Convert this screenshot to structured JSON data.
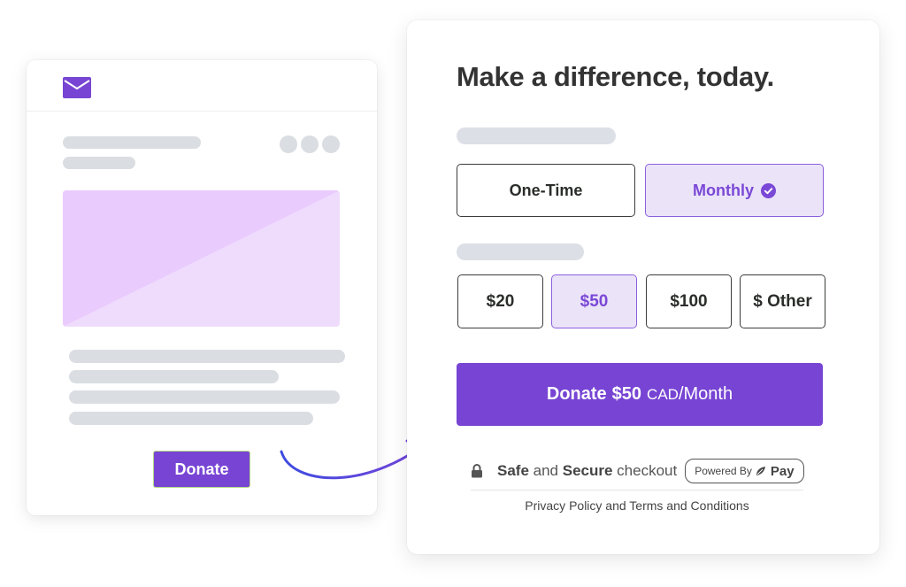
{
  "email_preview": {
    "icon": "mail-icon",
    "donate_button": "Donate",
    "colors": {
      "accent": "#7744d4",
      "image_top": "#e9cbfd",
      "image_bottom": "#efdcfd",
      "skeleton": "#dadde2"
    }
  },
  "arrow": {
    "icon": "curved-arrow-icon",
    "color_start": "#3d4be0",
    "color_end": "#7a44d8"
  },
  "donation_form": {
    "title": "Make a difference, today.",
    "frequency_options": [
      {
        "label": "One-Time",
        "selected": false
      },
      {
        "label": "Monthly",
        "selected": true,
        "icon": "check-circle-icon"
      }
    ],
    "amount_options": [
      {
        "label": "$20",
        "selected": false
      },
      {
        "label": "$50",
        "selected": true
      },
      {
        "label": "$100",
        "selected": false
      },
      {
        "label": "$ Other",
        "selected": false
      }
    ],
    "cta": {
      "action": "Donate",
      "amount": "$50",
      "currency": "CAD",
      "period": "/Month"
    },
    "secure": {
      "word1": "Safe",
      "and": " and ",
      "word2": "Secure",
      "tail": " checkout",
      "icon": "lock-icon"
    },
    "powered_by": {
      "label": "Powered By",
      "brand": "Pay",
      "icon": "leaf-logo-icon"
    },
    "legal_link": "Privacy Policy and Terms and Conditions",
    "colors": {
      "accent": "#7744d4",
      "selected_bg": "#ebe4f9",
      "selected_border": "#8b5fdd",
      "title": "#333333"
    }
  }
}
